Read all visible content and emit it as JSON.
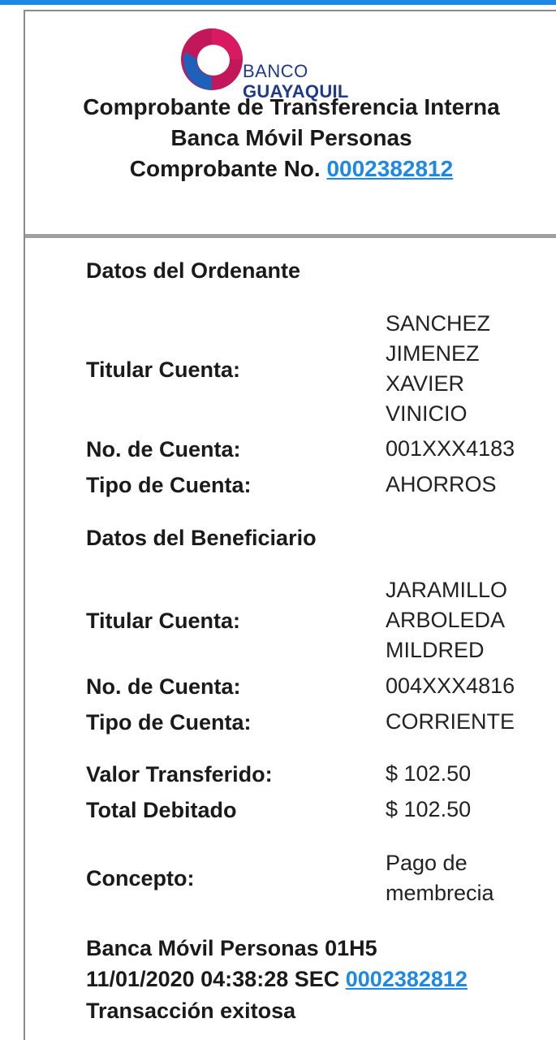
{
  "header": {
    "logo_banco": "BANCO",
    "logo_guayaquil": "GUAYAQUIL",
    "title": "Comprobante de Transferencia Interna",
    "subtitle": "Banca Móvil Personas",
    "receipt_label": "Comprobante No.",
    "receipt_number": "0002382812"
  },
  "ordenante": {
    "section_title": "Datos del Ordenante",
    "titular_label": "Titular Cuenta:",
    "titular_lines": [
      "SANCHEZ",
      "JIMENEZ",
      "XAVIER",
      "VINICIO"
    ],
    "cuenta_label": "No. de Cuenta:",
    "cuenta_value": "001XXX4183",
    "tipo_label": "Tipo de Cuenta:",
    "tipo_value": "AHORROS"
  },
  "beneficiario": {
    "section_title": "Datos del Beneficiario",
    "titular_label": "Titular Cuenta:",
    "titular_lines": [
      "JARAMILLO",
      "ARBOLEDA",
      "MILDRED"
    ],
    "cuenta_label": "No. de Cuenta:",
    "cuenta_value": "004XXX4816",
    "tipo_label": "Tipo de Cuenta:",
    "tipo_value": "CORRIENTE"
  },
  "amounts": {
    "valor_label": "Valor Transferido:",
    "valor_value": "$ 102.50",
    "total_label": "Total Debitado",
    "total_value": "$ 102.50"
  },
  "concepto": {
    "label": "Concepto:",
    "lines": [
      "Pago de",
      "membrecia"
    ]
  },
  "footer": {
    "line1": "Banca Móvil Personas 01H5",
    "line2_prefix": "11/01/2020 04:38:28 SEC",
    "line2_link": "0002382812",
    "line3": "Transacción exitosa"
  },
  "colors": {
    "accent": "#1e88e5",
    "logo_navy": "#1e3a8a",
    "logo_magenta": "#c2185b",
    "logo_blue": "#1565c0"
  }
}
